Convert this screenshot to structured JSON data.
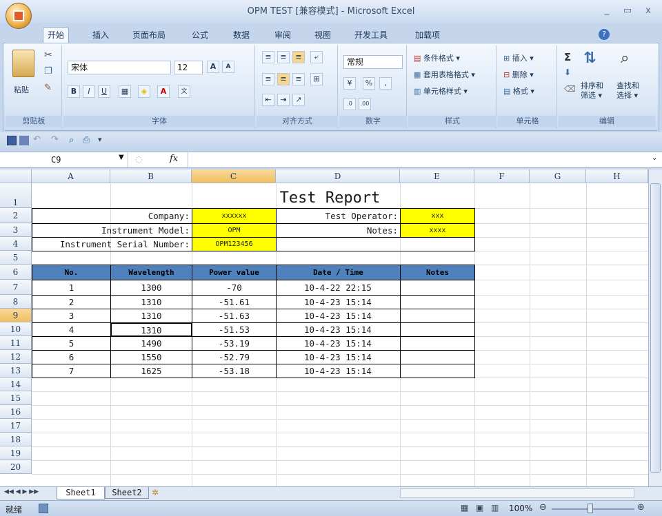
{
  "window": {
    "title": "OPM TEST  [兼容模式] - Microsoft Excel",
    "controls": [
      "_",
      "▭",
      "x"
    ]
  },
  "tabs": [
    "开始",
    "插入",
    "页面布局",
    "公式",
    "数据",
    "审阅",
    "视图",
    "开发工具",
    "加载项"
  ],
  "ribbon": {
    "clipboard": {
      "paste": "粘贴",
      "label": "剪贴板"
    },
    "font": {
      "name": "宋体",
      "size": "12",
      "label": "字体"
    },
    "alignment": {
      "label": "对齐方式"
    },
    "number": {
      "format": "常规",
      "percent": "%",
      "comma": ",",
      "label": "数字"
    },
    "styles": {
      "items": [
        "条件格式 ▾",
        "套用表格格式 ▾",
        "单元格样式 ▾"
      ],
      "label": "样式"
    },
    "cells": {
      "items": [
        "插入 ▾",
        "删除 ▾",
        "格式 ▾"
      ],
      "label": "单元格"
    },
    "editing": {
      "sort": "排序和\n筛选 ▾",
      "find": "查找和\n选择 ▾",
      "label": "编辑"
    }
  },
  "formula_bar": {
    "name_box": "C9",
    "fx": "fx",
    "value": ""
  },
  "columns": [
    "A",
    "B",
    "C",
    "D",
    "E",
    "F",
    "G",
    "H"
  ],
  "rows": [
    "1",
    "2",
    "3",
    "4",
    "5",
    "6",
    "7",
    "8",
    "9",
    "10",
    "11",
    "12",
    "13",
    "14",
    "15",
    "16",
    "17",
    "18",
    "19",
    "20"
  ],
  "sheet": {
    "title": "Test Report",
    "info": {
      "company_label": "Company:",
      "company": "xxxxxx",
      "operator_label": "Test Operator:",
      "operator": "xxx",
      "model_label": "Instrument Model:",
      "model": "OPM",
      "notes_label": "Notes:",
      "notes": "xxxx",
      "serial_label": "Instrument Serial Number:",
      "serial": "OPM123456"
    },
    "table_headers": [
      "No.",
      "Wavelength",
      "Power value",
      "Date / Time",
      "Notes"
    ],
    "table_rows": [
      [
        "1",
        "1300",
        "-70",
        "10-4-22 22:15",
        ""
      ],
      [
        "2",
        "1310",
        "-51.61",
        "10-4-23 15:14",
        ""
      ],
      [
        "3",
        "1310",
        "-51.63",
        "10-4-23 15:14",
        ""
      ],
      [
        "4",
        "1310",
        "-51.53",
        "10-4-23 15:14",
        ""
      ],
      [
        "5",
        "1490",
        "-53.19",
        "10-4-23 15:14",
        ""
      ],
      [
        "6",
        "1550",
        "-52.79",
        "10-4-23 15:14",
        ""
      ],
      [
        "7",
        "1625",
        "-53.18",
        "10-4-23 15:14",
        ""
      ]
    ]
  },
  "sheet_tabs": [
    "Sheet1",
    "Sheet2"
  ],
  "status": {
    "ready": "就绪",
    "zoom": "100%"
  },
  "colors": {
    "header_blue": "#4f81bd",
    "highlight": "#ffff00"
  }
}
